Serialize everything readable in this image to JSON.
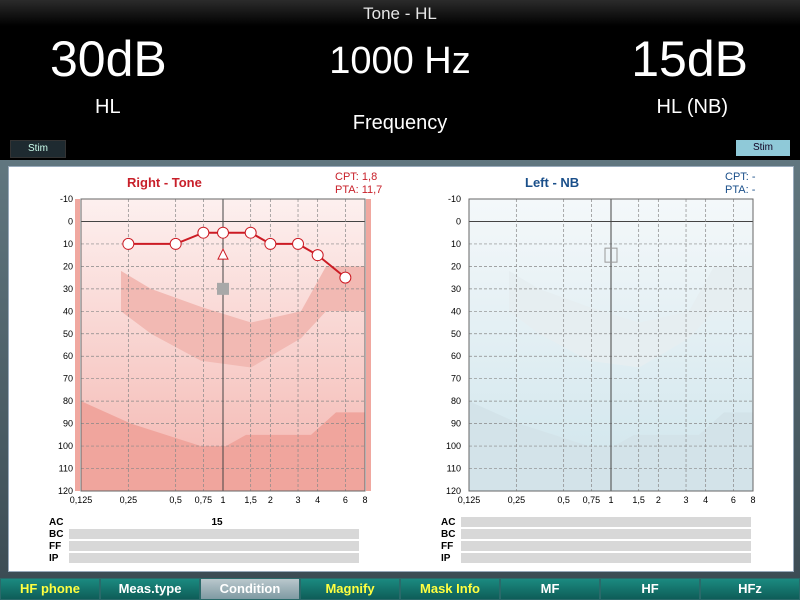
{
  "header": {
    "mode": "Tone - HL",
    "left_level": "30dB",
    "left_unit": "HL",
    "frequency": "1000 Hz",
    "frequency_label": "Frequency",
    "right_level": "15dB",
    "right_unit": "HL (NB)",
    "stim_left": "Stim",
    "stim_right": "Stim"
  },
  "right_panel": {
    "title": "Right - Tone",
    "cpt": "CPT: 1,8",
    "pta": "PTA: 11,7",
    "color": "#c8202a"
  },
  "left_panel": {
    "title": "Left - NB",
    "cpt": "CPT:  -",
    "pta": "PTA:  -",
    "color": "#1a4f8a"
  },
  "axes": {
    "y_ticks": [
      "-10",
      "0",
      "10",
      "20",
      "30",
      "40",
      "50",
      "60",
      "70",
      "80",
      "90",
      "100",
      "110",
      "120"
    ],
    "x_ticks": [
      "0,125",
      "0,25",
      "0,5",
      "0,75",
      "1",
      "1,5",
      "2",
      "3",
      "4",
      "6",
      "8"
    ]
  },
  "chart_data": [
    {
      "type": "line",
      "title": "Right - Tone",
      "x_unit": "kHz",
      "ylim": [
        -10,
        120
      ],
      "y_inverted": true,
      "grid": true,
      "series": [
        {
          "values_khz": [
            0.25,
            0.5,
            0.75,
            1,
            1.5,
            2,
            3,
            4,
            6
          ],
          "values_db": [
            10,
            10,
            5,
            5,
            5,
            10,
            10,
            15,
            25
          ],
          "marker": "circle"
        }
      ],
      "annotations": [
        {
          "kind": "triangle",
          "x_khz": 1,
          "y_db": 15
        },
        {
          "kind": "square",
          "x_khz": 1,
          "y_db": 30
        }
      ]
    },
    {
      "type": "line",
      "title": "Left - NB",
      "x_unit": "kHz",
      "ylim": [
        -10,
        120
      ],
      "y_inverted": true,
      "grid": true,
      "series": [],
      "annotations": [
        {
          "kind": "hollow-square",
          "x_khz": 1,
          "y_db": 15
        }
      ]
    }
  ],
  "table": {
    "rows": [
      "AC",
      "BC",
      "FF",
      "IP"
    ],
    "right_ac_value": "15"
  },
  "fkeys": [
    {
      "label": "HF phone",
      "color": "#ffff40"
    },
    {
      "label": "Meas.type",
      "color": "#ffffff"
    },
    {
      "label": "Condition",
      "color": "#ffffff"
    },
    {
      "label": "Magnify",
      "color": "#ffff40"
    },
    {
      "label": "Mask Info",
      "color": "#ffff40"
    },
    {
      "label": "MF",
      "color": "#ffffff"
    },
    {
      "label": "HF",
      "color": "#ffffff"
    },
    {
      "label": "HFz",
      "color": "#ffffff"
    }
  ]
}
